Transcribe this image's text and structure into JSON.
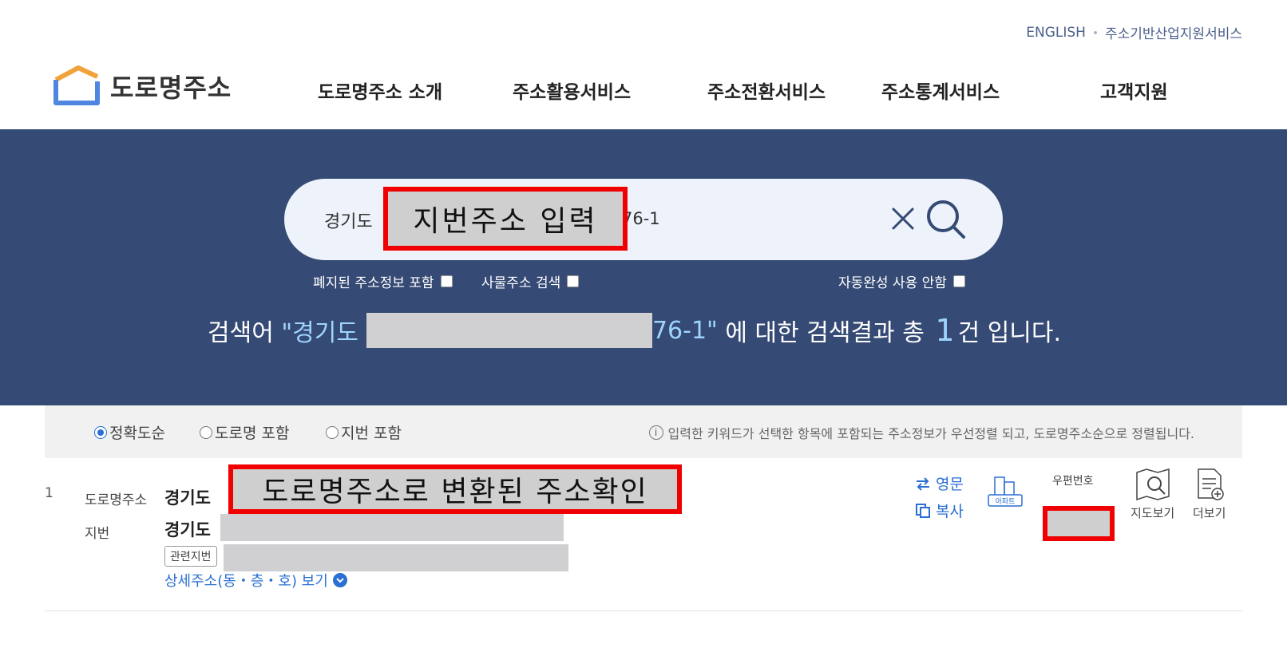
{
  "util": {
    "english": "ENGLISH",
    "industry": "주소기반산업지원서비스"
  },
  "logo": {
    "text": "도로명주소"
  },
  "nav": [
    "도로명주소 소개",
    "주소활용서비스",
    "주소전환서비스",
    "주소통계서비스",
    "고객지원"
  ],
  "search": {
    "prefix": "경기도",
    "suffix": "76-1",
    "overlay": "지번주소 입력"
  },
  "options": {
    "include_abolished": "폐지된 주소정보 포함",
    "building_search": "사물주소 검색",
    "no_autocomplete": "자동완성 사용 안함"
  },
  "result": {
    "lead": "검색어",
    "query_prefix": "\"경기도",
    "query_suffix": "76-1\"",
    "mid": "에 대한 검색결과 총",
    "count": "1",
    "tail": "건 입니다."
  },
  "sort": {
    "exact": "정확도순",
    "road": "도로명 포함",
    "jibun": "지번 포함",
    "note": "입력한 키워드가 선택한 항목에 포함되는 주소정보가 우선정렬 되고, 도로명주소순으로 정렬됩니다."
  },
  "row": {
    "num": "1",
    "road_label": "도로명주소",
    "road_value": "경기도",
    "jibun_label": "지번",
    "jibun_value": "경기도",
    "related_tag": "관련지번",
    "detail_link": "상세주소(동・층・호) 보기",
    "overlay": "도로명주소로 변환된 주소확인",
    "english": "영문",
    "copy": "복사",
    "apt": "아파트",
    "zip_label": "우편번호",
    "map": "지도보기",
    "more": "더보기"
  },
  "colors": {
    "hero_bg": "#354a74",
    "accent": "#2a6fd3",
    "highlight_border": "#f00000"
  }
}
